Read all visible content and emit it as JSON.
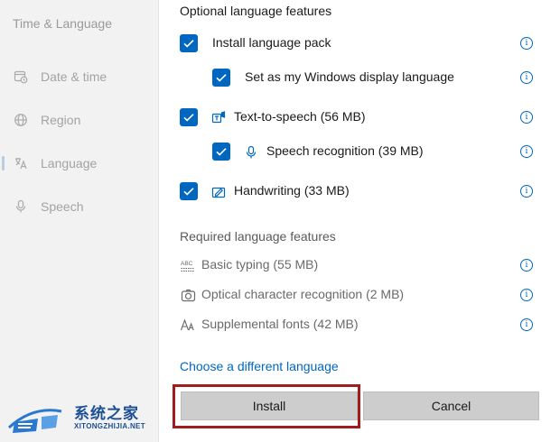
{
  "sidebar": {
    "title": "Time & Language",
    "items": [
      {
        "label": "Date & time",
        "icon": "clock-calendar-icon"
      },
      {
        "label": "Region",
        "icon": "globe-icon"
      },
      {
        "label": "Language",
        "icon": "language-icon",
        "active": true
      },
      {
        "label": "Speech",
        "icon": "microphone-icon"
      }
    ]
  },
  "dialog": {
    "optional_label": "Optional language features",
    "optional": [
      {
        "label": "Install language pack",
        "checked": true,
        "icon": null
      },
      {
        "label": "Set as my Windows display language",
        "checked": true,
        "icon": null
      },
      {
        "label": "Text-to-speech (56 MB)",
        "checked": true,
        "icon": "text-to-speech-icon"
      },
      {
        "label": "Speech recognition (39 MB)",
        "checked": true,
        "icon": "microphone-icon"
      },
      {
        "label": "Handwriting (33 MB)",
        "checked": true,
        "icon": "handwriting-icon"
      }
    ],
    "required_label": "Required language features",
    "required": [
      {
        "label": "Basic typing (55 MB)",
        "icon": "abc-typing-icon"
      },
      {
        "label": "Optical character recognition (2 MB)",
        "icon": "camera-ocr-icon"
      },
      {
        "label": "Supplemental fonts (42 MB)",
        "icon": "fonts-icon"
      }
    ],
    "link": "Choose a different language",
    "install_label": "Install",
    "cancel_label": "Cancel",
    "info_glyph": "i"
  },
  "watermark": {
    "cn": "系统之家",
    "en": "XITONGZHIJIA.NET"
  },
  "colors": {
    "accent": "#0067c0",
    "highlight": "#a11c1c",
    "watermark": "#1c4f95"
  }
}
